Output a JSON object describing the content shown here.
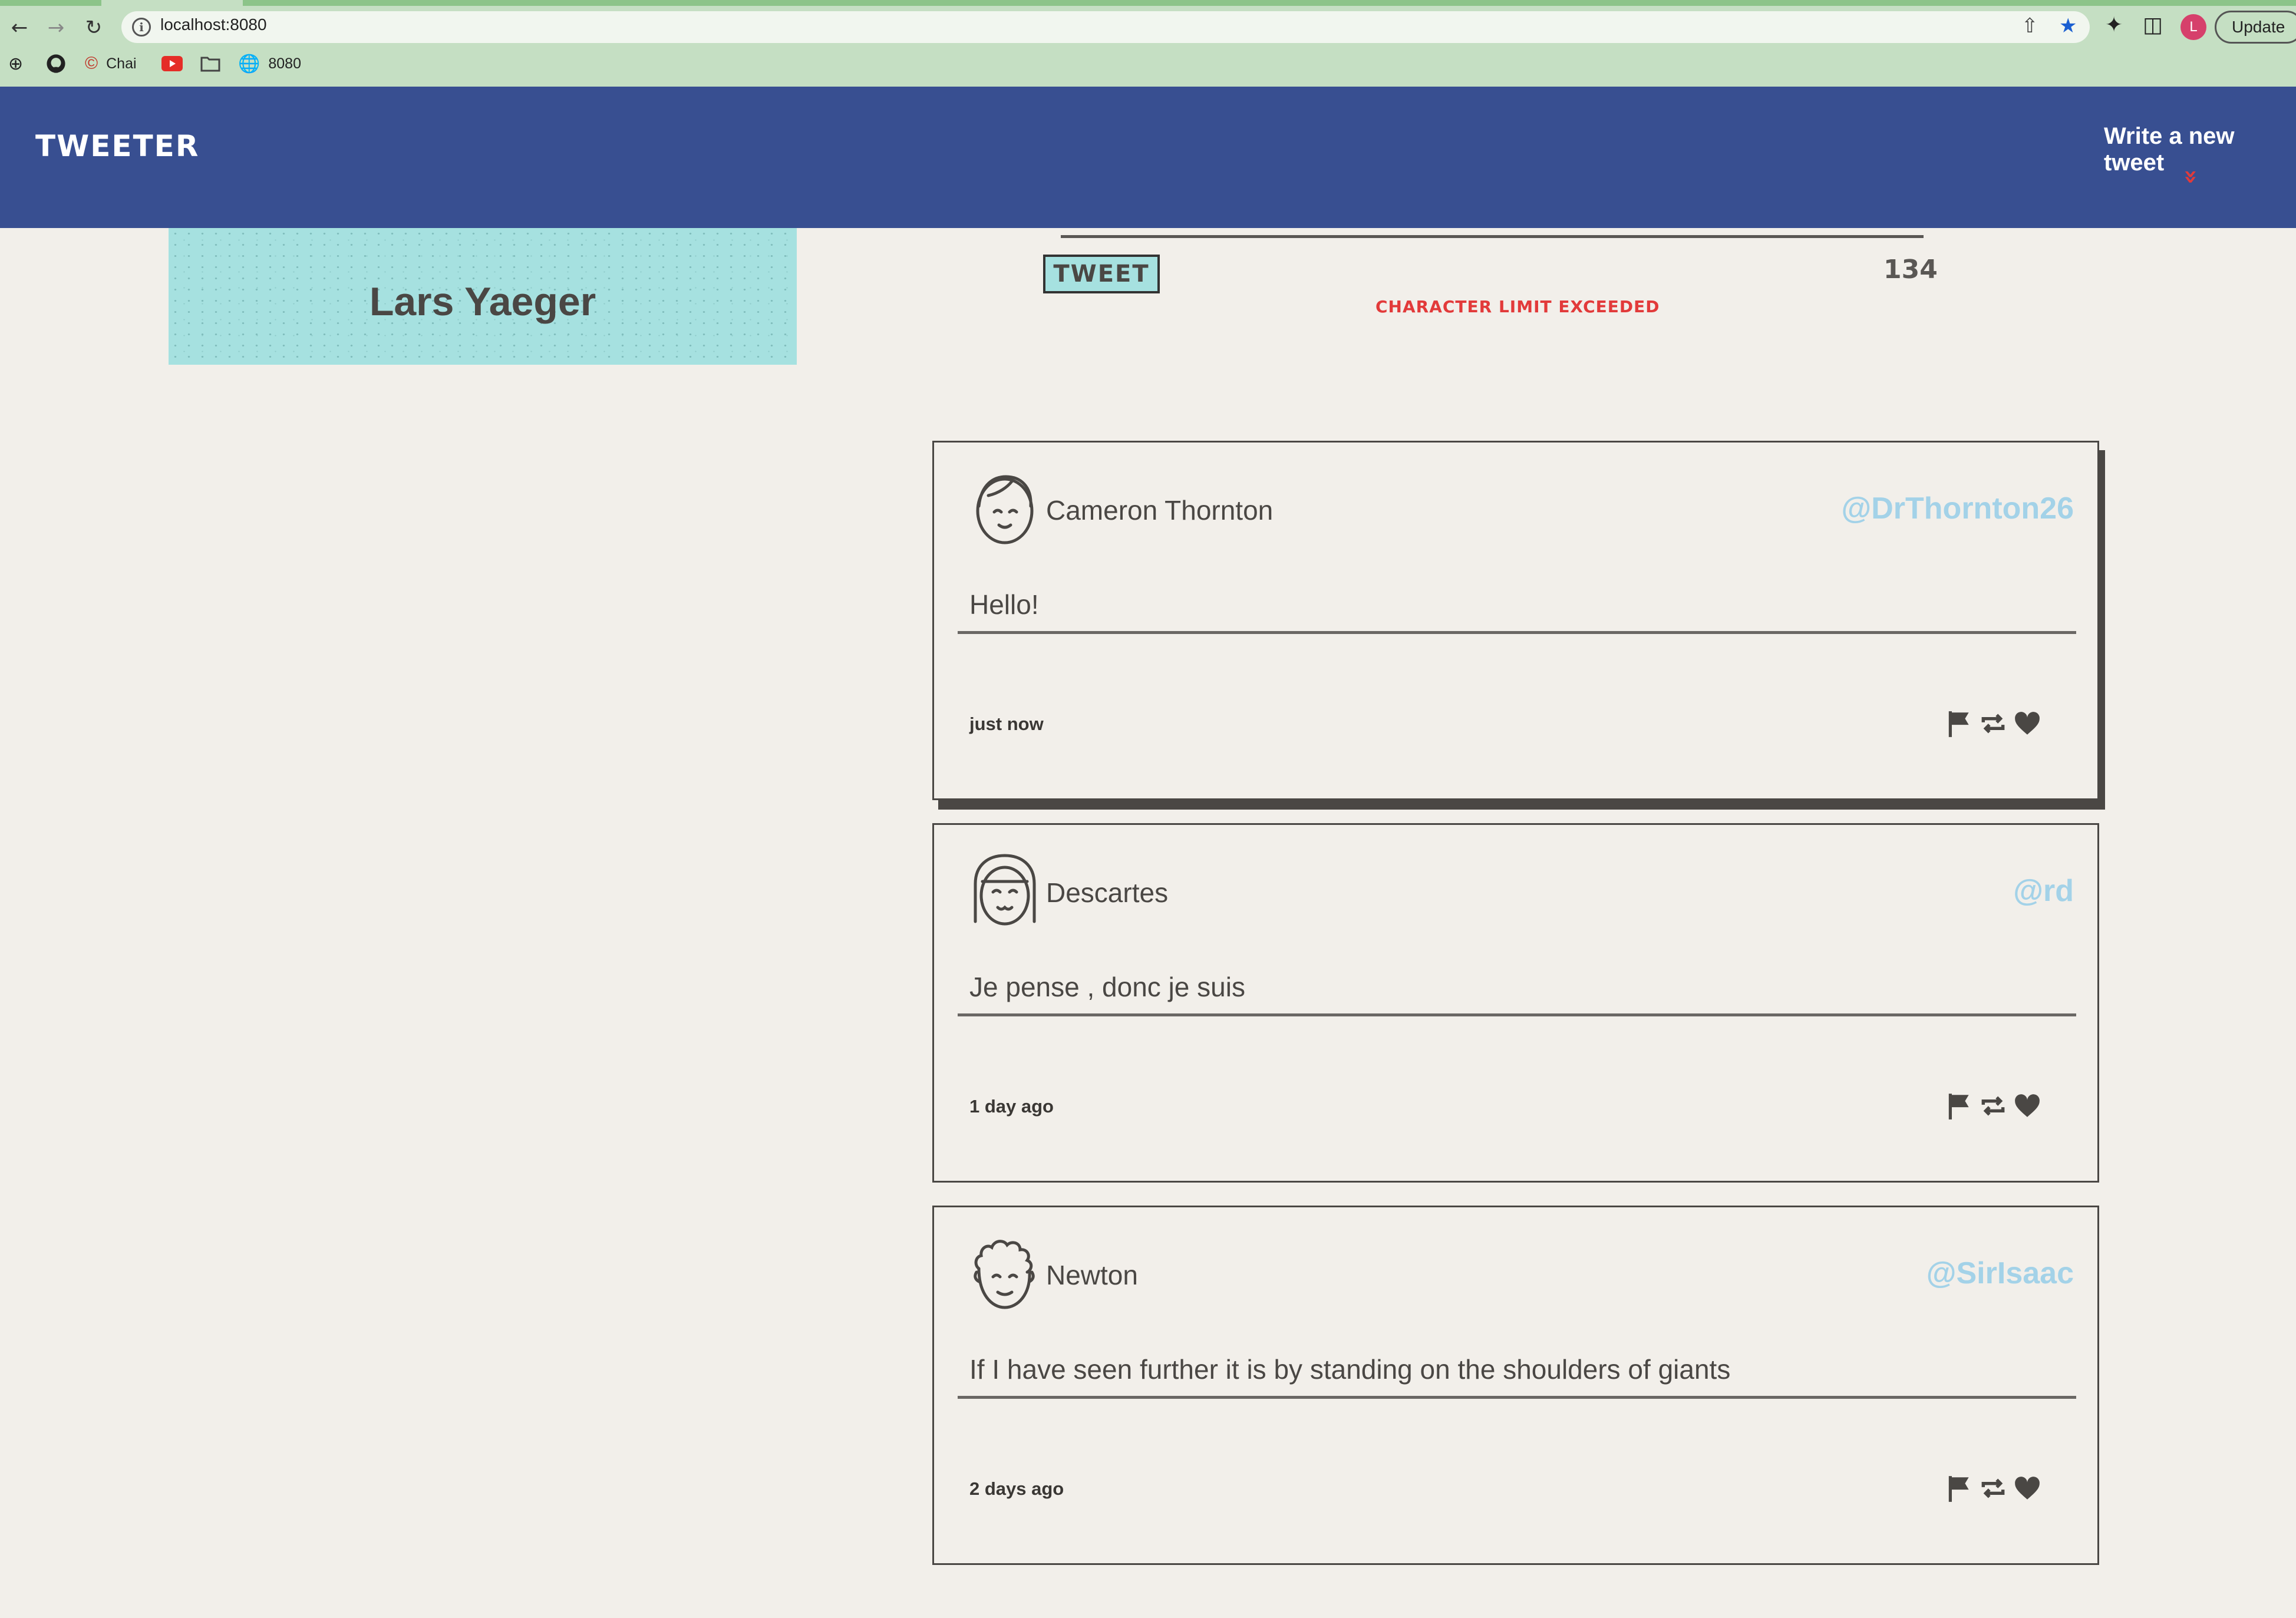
{
  "browser": {
    "url": "localhost:8080",
    "update_label": "Update",
    "profile_initial": "L",
    "bookmarks": [
      {
        "label": ""
      },
      {
        "label": ""
      },
      {
        "label": "Chai"
      },
      {
        "label": ""
      },
      {
        "label": ""
      },
      {
        "label": "8080"
      }
    ]
  },
  "header": {
    "logo": "TWEETER",
    "write_new_tweet": "Write a new tweet"
  },
  "profile": {
    "name": "Lars Yaeger"
  },
  "compose": {
    "tweet_button": "TWEET",
    "counter": "134",
    "error": "CHARACTER LIMIT EXCEEDED"
  },
  "tweets": [
    {
      "name": "Cameron Thornton",
      "handle": "@DrThornton26",
      "text": "Hello!",
      "time": "just now"
    },
    {
      "name": "Descartes",
      "handle": "@rd",
      "text": "Je pense , donc je suis",
      "time": "1 day ago"
    },
    {
      "name": "Newton",
      "handle": "@SirIsaac",
      "text": "If I have seen further it is by standing on the shoulders of giants",
      "time": "2 days ago"
    }
  ],
  "colors": {
    "header_bg": "#384f91",
    "accent_red": "#e23a3a",
    "profile_bg": "#a6e1e0",
    "handle": "#a3d2e8",
    "page_bg": "#f2efea"
  }
}
